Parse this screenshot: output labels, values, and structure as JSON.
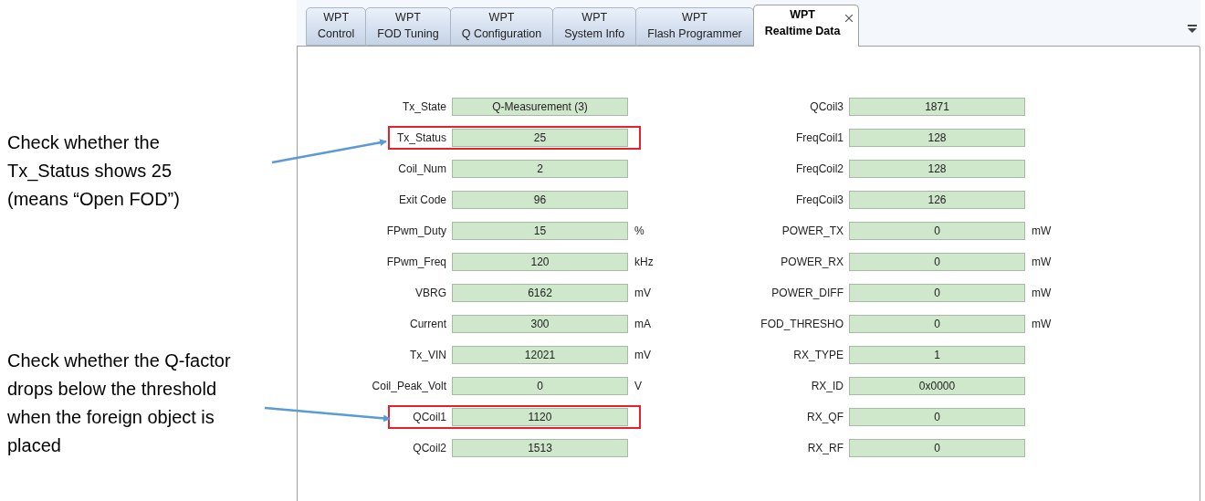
{
  "annotations": [
    {
      "text": "Check whether the Tx_Status shows 25 (means “Open FOD”)"
    },
    {
      "text": "Check whether the Q-factor drops below the threshold when the foreign object is placed"
    }
  ],
  "tabs": [
    {
      "line1": "WPT",
      "line2": "Control",
      "selected": false
    },
    {
      "line1": "WPT",
      "line2": "FOD Tuning",
      "selected": false
    },
    {
      "line1": "WPT",
      "line2": "Q Configuration",
      "selected": false
    },
    {
      "line1": "WPT",
      "line2": "System Info",
      "selected": false
    },
    {
      "line1": "WPT",
      "line2": "Flash Programmer",
      "selected": false
    },
    {
      "line1": "WPT",
      "line2": "Realtime Data",
      "selected": true
    }
  ],
  "left": [
    {
      "label": "Tx_State",
      "value": "Q-Measurement (3)",
      "highlighted": false
    },
    {
      "label": "Tx_Status",
      "value": "25",
      "highlighted": true
    },
    {
      "label": "Coil_Num",
      "value": "2",
      "highlighted": false
    },
    {
      "label": "Exit Code",
      "value": "96",
      "highlighted": false
    },
    {
      "label": "FPwm_Duty",
      "value": "15",
      "unit": "%",
      "highlighted": false
    },
    {
      "label": "FPwm_Freq",
      "value": "120",
      "unit": "kHz",
      "highlighted": false
    },
    {
      "label": "VBRG",
      "value": "6162",
      "unit": "mV",
      "highlighted": false
    },
    {
      "label": "Current",
      "value": "300",
      "unit": "mA",
      "highlighted": false
    },
    {
      "label": "Tx_VIN",
      "value": "12021",
      "unit": "mV",
      "highlighted": false
    },
    {
      "label": "Coil_Peak_Volt",
      "value": "0",
      "unit": "V",
      "highlighted": false
    },
    {
      "label": "QCoil1",
      "value": "1120",
      "highlighted": true
    },
    {
      "label": "QCoil2",
      "value": "1513",
      "highlighted": false
    }
  ],
  "right": [
    {
      "label": "QCoil3",
      "value": "1871",
      "highlighted": false
    },
    {
      "label": "FreqCoil1",
      "value": "128",
      "highlighted": false
    },
    {
      "label": "FreqCoil2",
      "value": "128",
      "highlighted": false
    },
    {
      "label": "FreqCoil3",
      "value": "126",
      "highlighted": false
    },
    {
      "label": "POWER_TX",
      "value": "0",
      "unit": "mW",
      "highlighted": false
    },
    {
      "label": "POWER_RX",
      "value": "0",
      "unit": "mW",
      "highlighted": false
    },
    {
      "label": "POWER_DIFF",
      "value": "0",
      "unit": "mW",
      "highlighted": false
    },
    {
      "label": "FOD_THRESHO",
      "value": "0",
      "unit": "mW",
      "highlighted": false
    },
    {
      "label": "RX_TYPE",
      "value": "1",
      "highlighted": false
    },
    {
      "label": "RX_ID",
      "value": "0x0000",
      "highlighted": false
    },
    {
      "label": "RX_QF",
      "value": "0",
      "highlighted": false
    },
    {
      "label": "RX_RF",
      "value": "0",
      "highlighted": false
    }
  ]
}
